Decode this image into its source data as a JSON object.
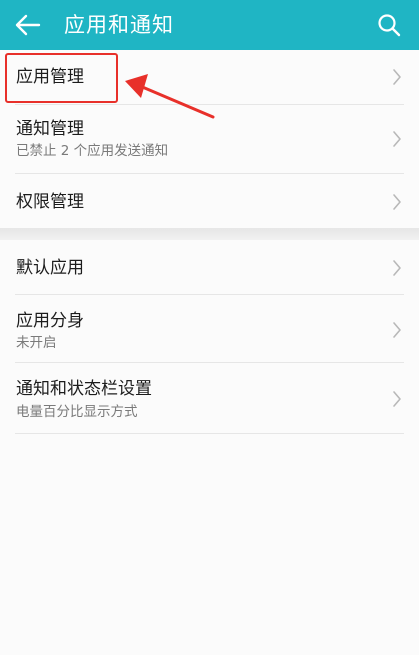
{
  "appbar": {
    "title": "应用和通知",
    "back_icon": "arrow-left-icon",
    "search_icon": "search-icon",
    "bg_color": "#1fb5c4"
  },
  "group_one": [
    {
      "title": "应用管理",
      "subtitle": ""
    },
    {
      "title": "通知管理",
      "subtitle": "已禁止 2 个应用发送通知"
    },
    {
      "title": "权限管理",
      "subtitle": ""
    }
  ],
  "group_two": [
    {
      "title": "默认应用",
      "subtitle": ""
    },
    {
      "title": "应用分身",
      "subtitle": "未开启"
    },
    {
      "title": "通知和状态栏设置",
      "subtitle": "电量百分比显示方式"
    }
  ],
  "annotation": {
    "color": "#e8302a",
    "target": "应用管理"
  }
}
